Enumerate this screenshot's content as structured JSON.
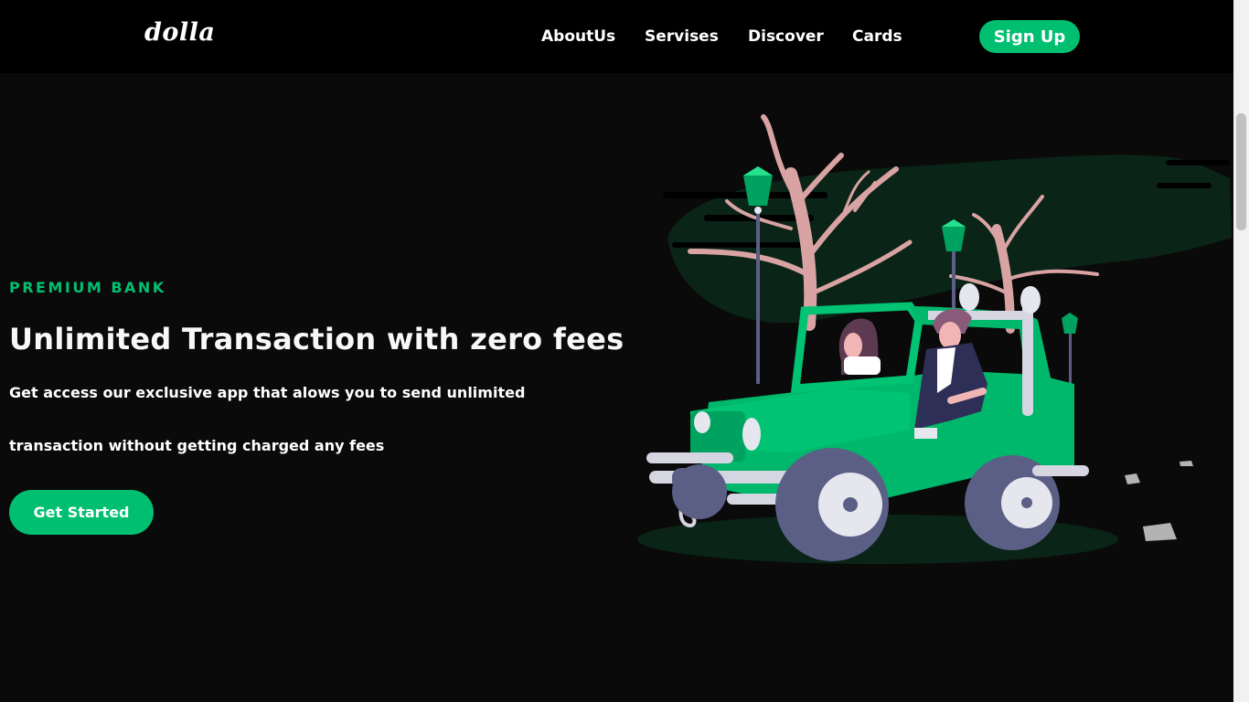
{
  "navbar": {
    "logo": "dolla",
    "links": [
      {
        "label": "AboutUs"
      },
      {
        "label": "Servises"
      },
      {
        "label": "Discover"
      },
      {
        "label": "Cards"
      }
    ],
    "signup_label": "Sign Up"
  },
  "hero": {
    "topline": "PREMIUM BANK",
    "heading": "Unlimited Transaction with zero fees",
    "description_line1": "Get access our exclusive app that alows you to send unlimited",
    "description_line2": "transaction without getting charged any fees",
    "button_label": "Get Started",
    "illustration": "couple-in-green-jeep-illustration"
  },
  "colors": {
    "accent": "#01bf71",
    "background": "#0a0a0a",
    "navbar": "#000000"
  }
}
